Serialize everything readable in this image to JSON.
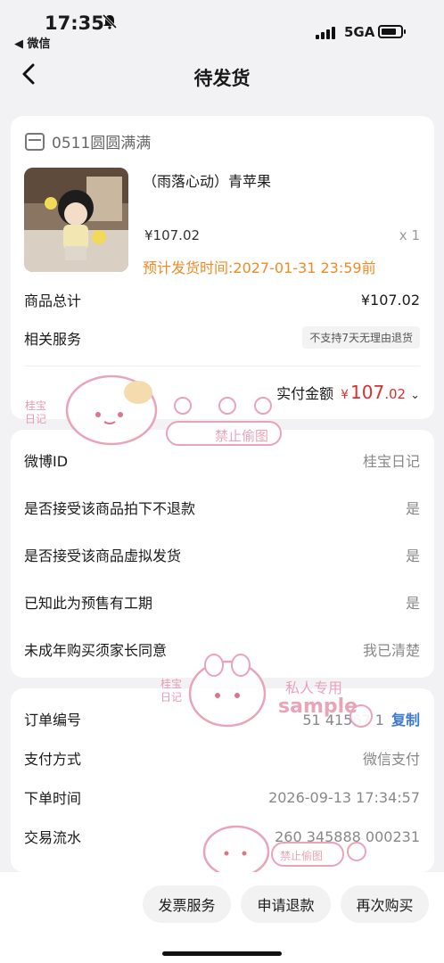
{
  "status_bar": {
    "time": "17:35",
    "back_app": "◀ 微信",
    "network": "5GA"
  },
  "nav": {
    "back_glyph": "<",
    "title": "待发货"
  },
  "order": {
    "shop_name": "0511圆圆满满",
    "product_title": "（雨落心动）青苹果",
    "price": "¥107.02",
    "quantity": "x 1",
    "estimated_ship": "预计发货时间:2027-01-31 23:59前",
    "goods_total_label": "商品总计",
    "goods_total_value": "¥107.02",
    "service_label": "相关服务",
    "service_tag": "不支持7天无理由退货",
    "paid_label": "实付金额",
    "paid_currency": "¥",
    "paid_integer": "107",
    "paid_decimal": ".02",
    "paid_chevron": "⌄"
  },
  "questions": [
    {
      "label": "微博ID",
      "value": "桂宝日记"
    },
    {
      "label": "是否接受该商品拍下不退款",
      "value": "是"
    },
    {
      "label": "是否接受该商品虚拟发货",
      "value": "是"
    },
    {
      "label": "已知此为预售有工期",
      "value": "是"
    },
    {
      "label": "未成年购买须家长同意",
      "value": "我已清楚"
    }
  ],
  "order_info": {
    "number_label": "订单编号",
    "number_value": "51  41567  1",
    "copy_label": "复制",
    "payment_label": "支付方式",
    "payment_value": "微信支付",
    "time_label": "下单时间",
    "time_value": "2026-09-13 17:34:57",
    "txn_label": "交易流水",
    "txn_value": "260   345888   000231"
  },
  "actions": {
    "invoice": "发票服务",
    "refund": "申请退款",
    "rebuy": "再次购买"
  },
  "watermarks": {
    "brand": "桂宝日记",
    "no_theft": "禁止偷图",
    "private": "私人专用",
    "sample": "sample"
  },
  "colors": {
    "accent_red": "#e02e2e",
    "ship_orange": "#f08a24",
    "link_blue": "#3c7ad6",
    "watermark_pink": "#e79bb0"
  }
}
